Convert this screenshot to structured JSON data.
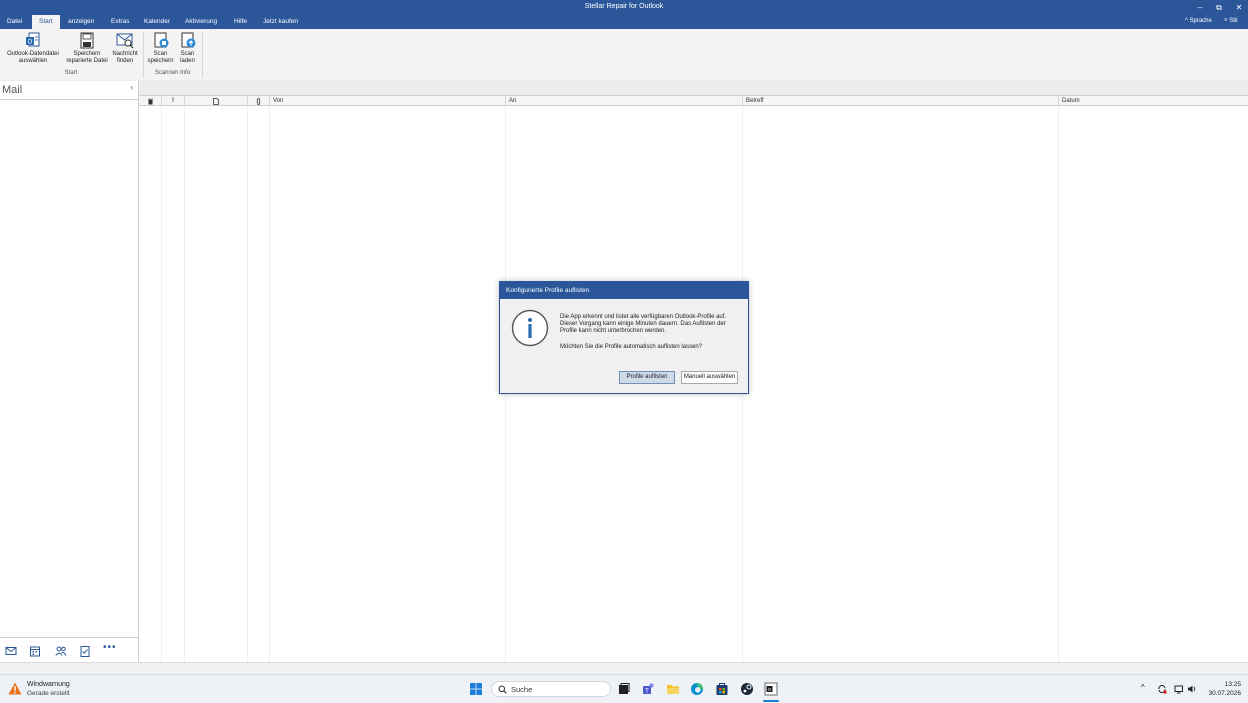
{
  "window": {
    "title": "Stellar Repair for Outlook",
    "minimize_glyph": "–",
    "restore_glyph": "⧉",
    "close_glyph": "✕"
  },
  "menu": {
    "tabs": [
      "Datei",
      "Start",
      "anzeigen",
      "Extras",
      "Kalender",
      "Aktivierung",
      "Hilfe",
      "Jetzt kaufen"
    ],
    "active_tab": "Start",
    "language": "Sprache",
    "style": "Stil"
  },
  "ribbon": {
    "buttons": [
      {
        "label1": "Outlook-Datendatei",
        "label2": "auswählen",
        "icon": "outlook-file-icon"
      },
      {
        "label1": "Speichern",
        "label2": "reparierte Datei",
        "icon": "save-icon"
      },
      {
        "label1": "Nachricht",
        "label2": "finden",
        "icon": "find-message-icon"
      },
      {
        "label1": "Scan",
        "label2": "speichern",
        "icon": "scan-save-icon"
      },
      {
        "label1": "Scan",
        "label2": "laden",
        "icon": "scan-load-icon"
      }
    ],
    "groups": [
      "Start",
      "Scannen Info"
    ]
  },
  "sidebar": {
    "title": "Mail",
    "collapse_glyph": "‹",
    "nav_icons": [
      "mail-icon",
      "calendar-icon",
      "contacts-icon",
      "tasks-icon",
      "more-icon"
    ]
  },
  "columns": [
    "Von",
    "An",
    "Betreff",
    "Datum"
  ],
  "column_icons": [
    "delete-icon",
    "importance-icon",
    "document-icon",
    "attachment-icon"
  ],
  "dialog": {
    "title": "Konfigurierte Profile auflisten",
    "message_lines": [
      "Die App erkennt und listet alle verfügbaren Outlook-Profile auf.",
      "Dieser Vorgang kann einige Minuten dauern. Das Auflisten der",
      "Profile kann nicht unterbrochen werden."
    ],
    "question": "Möchten Sie die Profile automatisch auflisten lassen?",
    "primary_button": "Profile auflisten",
    "secondary_button": "Manuell auswählen"
  },
  "taskbar": {
    "warning_title": "Windwarnung",
    "warning_subtitle": "Gerade erstellt",
    "search_placeholder": "Suche",
    "time": "13:25",
    "date": "30.07.2026",
    "apps": [
      "windows-start-icon",
      "search-icon",
      "task-view-icon",
      "teams-icon",
      "file-explorer-icon",
      "edge-icon",
      "store-icon",
      "steam-icon",
      "stellar-app-icon"
    ]
  },
  "colors": {
    "accent": "#2b579a",
    "ribbon_bg": "#f3f3f3",
    "dialog_bg": "#f0f0f0"
  }
}
